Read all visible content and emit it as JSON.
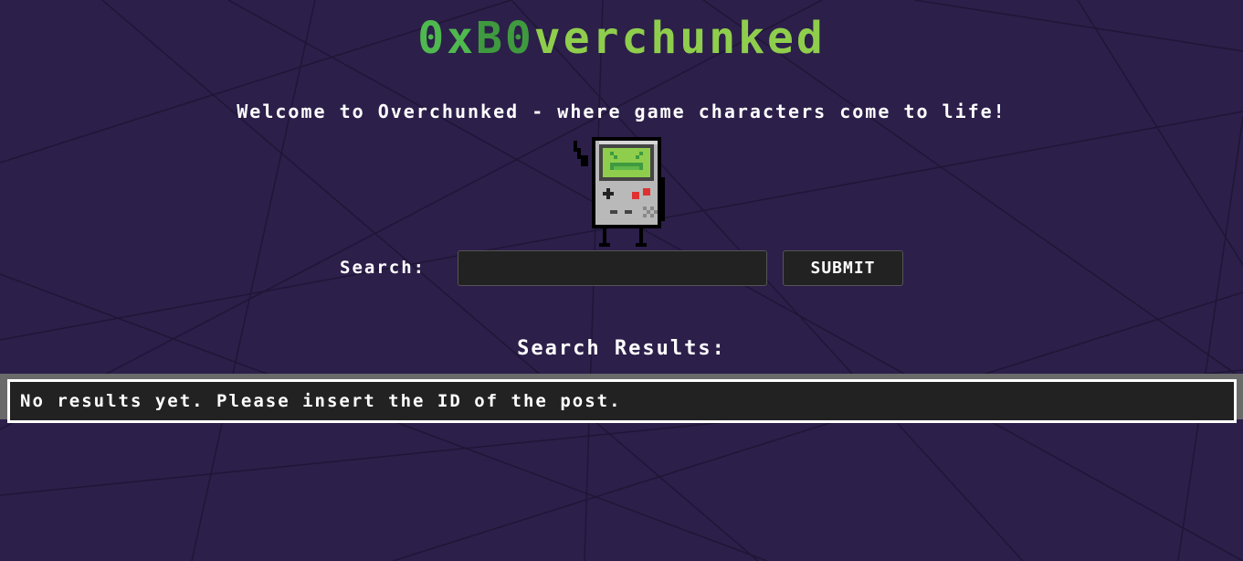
{
  "header": {
    "title_part1": "0x",
    "title_part2": "B0",
    "title_part3": "verchunked"
  },
  "welcome": {
    "text": "Welcome to Overchunked - where game characters come to life!"
  },
  "mascot": {
    "icon": "gameboy-mascot-icon"
  },
  "search": {
    "label": "Search:",
    "placeholder": "",
    "value": "",
    "submit_label": "SUBMIT"
  },
  "results": {
    "heading": "Search Results:",
    "message": "No results yet. Please insert the ID of the post."
  },
  "colors": {
    "background": "#2c1f4a",
    "title_green": "#4fb84f",
    "title_dark_green": "#3f9a3f",
    "title_light_green": "#8fce4c",
    "panel": "#222222"
  }
}
